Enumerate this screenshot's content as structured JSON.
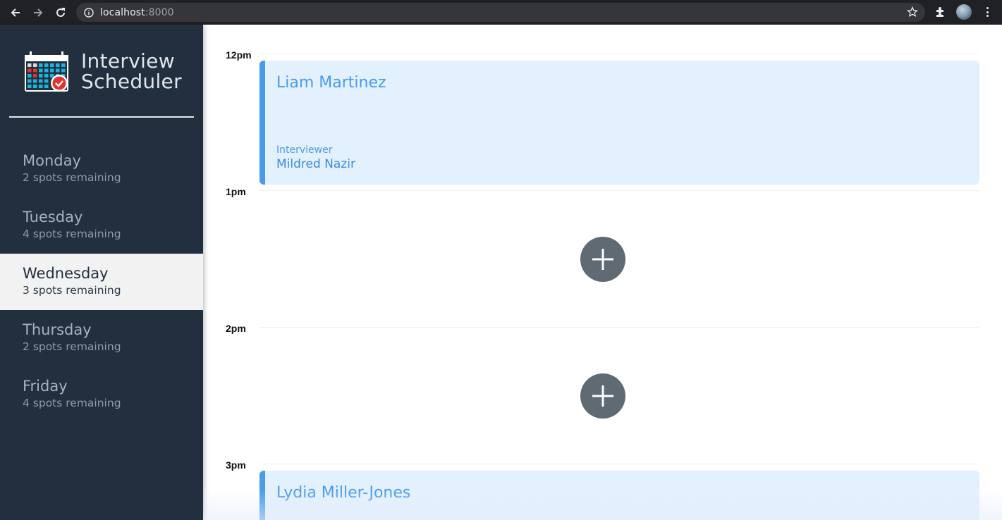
{
  "browser": {
    "url_host": "localhost",
    "url_port": ":8000"
  },
  "sidebar": {
    "title_line1": "Interview",
    "title_line2": "Scheduler",
    "days": [
      {
        "name": "Monday",
        "spots": "2 spots remaining",
        "selected": false
      },
      {
        "name": "Tuesday",
        "spots": "4 spots remaining",
        "selected": false
      },
      {
        "name": "Wednesday",
        "spots": "3 spots remaining",
        "selected": true
      },
      {
        "name": "Thursday",
        "spots": "2 spots remaining",
        "selected": false
      },
      {
        "name": "Friday",
        "spots": "4 spots remaining",
        "selected": false
      }
    ]
  },
  "schedule": {
    "slots": [
      {
        "time": "12pm",
        "booked": true,
        "student": "Liam Martinez",
        "interviewer_label": "Interviewer",
        "interviewer": "Mildred Nazir"
      },
      {
        "time": "1pm",
        "booked": false
      },
      {
        "time": "2pm",
        "booked": false
      },
      {
        "time": "3pm",
        "booked": true,
        "student": "Lydia Miller-Jones"
      }
    ]
  },
  "colors": {
    "sidebar_bg": "#222f3e",
    "selected_day_bg": "#f2f2f2",
    "card_bg": "#e3f0fe",
    "accent": "#4a9bec",
    "add_button": "#5f6a73"
  },
  "icons": {
    "back": "arrow-left-icon",
    "forward": "arrow-right-icon",
    "reload": "reload-icon",
    "info": "info-icon",
    "bookmark": "star-icon",
    "extensions": "puzzle-icon",
    "menu": "more-vert-icon",
    "logo": "calendar-check-icon",
    "add": "plus-icon"
  }
}
